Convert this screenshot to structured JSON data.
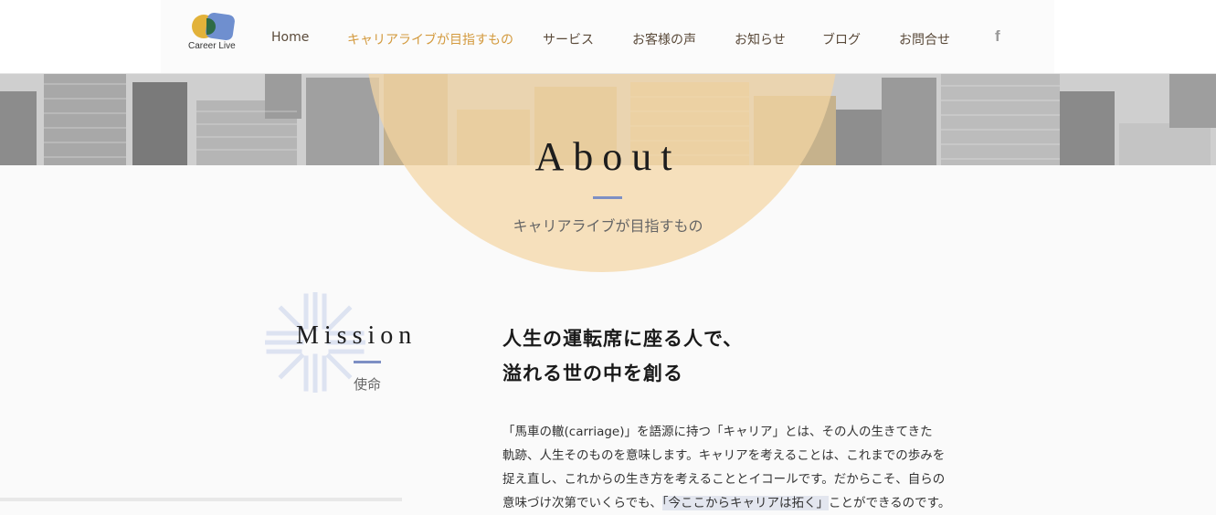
{
  "header": {
    "logo_text": "Career Live",
    "nav": [
      {
        "label": "Home",
        "active": false
      },
      {
        "label": "キャリアライブが目指すもの",
        "active": true
      },
      {
        "label": "サービス",
        "active": false
      },
      {
        "label": "お客様の声",
        "active": false
      },
      {
        "label": "お知らせ",
        "active": false
      },
      {
        "label": "ブログ",
        "active": false
      },
      {
        "label": "お問合せ",
        "active": false
      }
    ],
    "social_icon": "f",
    "active_color": "#d39a3e"
  },
  "hero": {
    "title": "About",
    "subtitle": "キャリアライブが目指すもの",
    "accent_color": "#7d8fc4",
    "circle_color": "#f4d6a3"
  },
  "mission": {
    "title": "Mission",
    "subtitle": "使命",
    "headline_line1": "人生の運転席に座る人で、",
    "headline_line2": "溢れる世の中を創る",
    "body_line1": "「馬車の轍(carriage)」を語源に持つ「キャリア」とは、その人の生きてきた",
    "body_line2": "軌跡、人生そのものを意味します。キャリアを考えることは、これまでの歩みを",
    "body_line3": "捉え直し、これからの生き方を考えることとイコールです。だからこそ、自らの",
    "body_line4_pre": "意味づけ次第でいくらでも、",
    "body_line4_highlight": "「今ここからキャリアは拓く」",
    "body_line4_post": "ことができるのです。"
  }
}
